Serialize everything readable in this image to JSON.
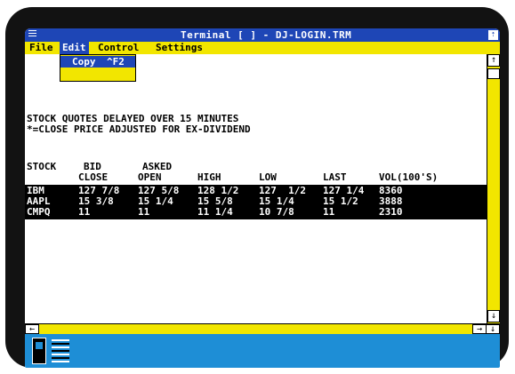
{
  "window": {
    "title": "Terminal  [  ] - DJ-LOGIN.TRM",
    "max_glyph": "⇡"
  },
  "menu": {
    "file": "File",
    "edit": "Edit",
    "control": "Control",
    "settings": "Settings"
  },
  "edit_menu": {
    "copy": "Copy",
    "copy_shortcut": "^F2"
  },
  "content": {
    "line1": "STOCK QUOTES DELAYED OVER 15 MINUTES",
    "line2": "*=CLOSE PRICE ADJUSTED FOR EX-DIVIDEND",
    "headers": {
      "stock": "STOCK",
      "bid": "BID",
      "close": "CLOSE",
      "asked": "ASKED",
      "open": "OPEN",
      "high": "HIGH",
      "low": "LOW",
      "last": "LAST",
      "vol": "VOL(100'S)"
    },
    "rows": [
      {
        "stock": "IBM",
        "close": "127 7/8",
        "open": "127 5/8",
        "high": "128 1/2",
        "low": "127  1/2",
        "last": "127 1/4",
        "vol": "8360"
      },
      {
        "stock": "AAPL",
        "close": "15 3/8",
        "open": "15 1/4",
        "high": "15 5/8",
        "low": "15 1/4",
        "last": "15 1/2",
        "vol": "3888"
      },
      {
        "stock": "CMPQ",
        "close": "11",
        "open": "11",
        "high": "11 1/4",
        "low": "10 7/8",
        "last": "11",
        "vol": "2310"
      }
    ]
  },
  "scroll": {
    "up": "↑",
    "down": "↓",
    "left": "←",
    "right": "→"
  },
  "colors": {
    "titlebar": "#1e46b6",
    "menubar": "#f2e600",
    "iconbar": "#1e8ed6"
  }
}
